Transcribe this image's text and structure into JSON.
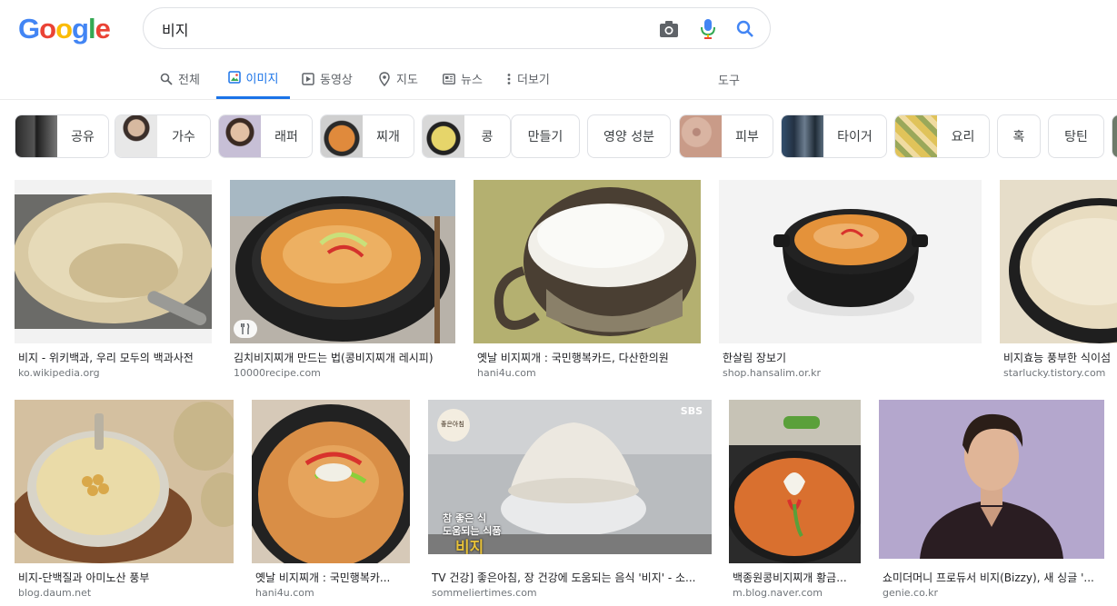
{
  "logo": {
    "letters": [
      "G",
      "o",
      "o",
      "g",
      "l",
      "e"
    ]
  },
  "search": {
    "query": "비지"
  },
  "tabs": [
    {
      "label": "전체",
      "icon": "search-icon"
    },
    {
      "label": "이미지",
      "icon": "image-icon",
      "active": true
    },
    {
      "label": "동영상",
      "icon": "play-icon"
    },
    {
      "label": "지도",
      "icon": "map-pin-icon"
    },
    {
      "label": "뉴스",
      "icon": "news-icon"
    },
    {
      "label": "더보기",
      "icon": "more-vertical-icon"
    }
  ],
  "tools_label": "도구",
  "chips": [
    {
      "label": "공유"
    },
    {
      "label": "가수"
    },
    {
      "label": "래퍼"
    },
    {
      "label": "찌개"
    },
    {
      "label": "콩"
    },
    {
      "label": "만들기"
    },
    {
      "label": "영양 성분"
    },
    {
      "label": "피부"
    },
    {
      "label": "타이거"
    },
    {
      "label": "요리"
    },
    {
      "label": "혹"
    },
    {
      "label": "탕틴"
    }
  ],
  "results_row1": [
    {
      "title": "비지 - 위키백과, 우리 모두의 백과사전",
      "domain": "ko.wikipedia.org"
    },
    {
      "title": "김치비지찌개 만드는 법(콩비지찌개 레시피)",
      "domain": "10000recipe.com"
    },
    {
      "title": "옛날 비지찌개 : 국민행복카드, 다산한의원",
      "domain": "hani4u.com"
    },
    {
      "title": "한살림 장보기",
      "domain": "shop.hansalim.or.kr"
    },
    {
      "title": "비지효능 풍부한 식이섬",
      "domain": "starlucky.tistory.com"
    }
  ],
  "results_row2": [
    {
      "title": "비지-단백질과 아미노산 풍부",
      "domain": "blog.daum.net"
    },
    {
      "title": "옛날 비지찌개 : 국민행복카...",
      "domain": "hani4u.com"
    },
    {
      "title": "TV 건강] 좋은아침, 장 건강에 도움되는 음식 '비지' - 소...",
      "domain": "sommeliertimes.com"
    },
    {
      "title": "백종원콩비지찌개 황금...",
      "domain": "m.blog.naver.com"
    },
    {
      "title": "쇼미더머니 프로듀서 비지(Bizzy), 새 싱글 '...",
      "domain": "genie.co.kr"
    }
  ],
  "image_overlay": {
    "sbs": "SBS",
    "caption_top": "참 좋은 식",
    "caption_mid": "도움되는 식품",
    "caption_big": "비지",
    "logo_top": "좋은아침"
  },
  "colors": {
    "accent": "#1a73e8",
    "text": "#202124",
    "muted": "#70757a"
  }
}
